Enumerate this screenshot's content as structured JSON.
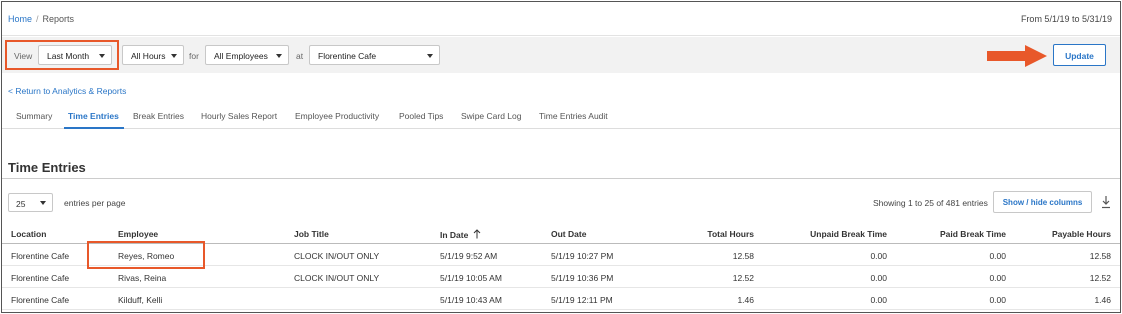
{
  "breadcrumb": {
    "home": "Home",
    "separator": "/",
    "current": "Reports"
  },
  "date_range": "From 5/1/19 to 5/31/19",
  "filters": {
    "view_label": "View",
    "view_value": "Last Month",
    "hours_value": "All Hours",
    "for_label": "for",
    "employees_value": "All Employees",
    "at_label": "at",
    "location_value": "Florentine Cafe",
    "update_label": "Update"
  },
  "back_link": "< Return to Analytics & Reports",
  "tabs": [
    {
      "label": "Summary",
      "active": false
    },
    {
      "label": "Time Entries",
      "active": true
    },
    {
      "label": "Break Entries",
      "active": false
    },
    {
      "label": "Hourly Sales Report",
      "active": false
    },
    {
      "label": "Employee Productivity",
      "active": false
    },
    {
      "label": "Pooled Tips",
      "active": false
    },
    {
      "label": "Swipe Card Log",
      "active": false
    },
    {
      "label": "Time Entries Audit",
      "active": false
    }
  ],
  "section_title": "Time Entries",
  "table_controls": {
    "per_page_value": "25",
    "per_page_label": "entries per page",
    "showing_text": "Showing 1 to 25 of 481 entries",
    "show_hide_label": "Show / hide columns"
  },
  "columns": [
    "Location",
    "Employee",
    "Job Title",
    "In Date",
    "Out Date",
    "Total Hours",
    "Unpaid Break Time",
    "Paid Break Time",
    "Payable Hours"
  ],
  "rows": [
    [
      "Florentine Cafe",
      "Reyes, Romeo",
      "CLOCK IN/OUT ONLY",
      "5/1/19 9:52 AM",
      "5/1/19 10:27 PM",
      "12.58",
      "0.00",
      "0.00",
      "12.58"
    ],
    [
      "Florentine Cafe",
      "Rivas, Reina",
      "CLOCK IN/OUT ONLY",
      "5/1/19 10:05 AM",
      "5/1/19 10:36 PM",
      "12.52",
      "0.00",
      "0.00",
      "12.52"
    ],
    [
      "Florentine Cafe",
      "Kilduff, Kelli",
      "",
      "5/1/19 10:43 AM",
      "5/1/19 12:11 PM",
      "1.46",
      "0.00",
      "0.00",
      "1.46"
    ]
  ],
  "colors": {
    "accent": "#2a76c7",
    "highlight": "#e8582a",
    "filter_bg": "#f2f2f2"
  }
}
